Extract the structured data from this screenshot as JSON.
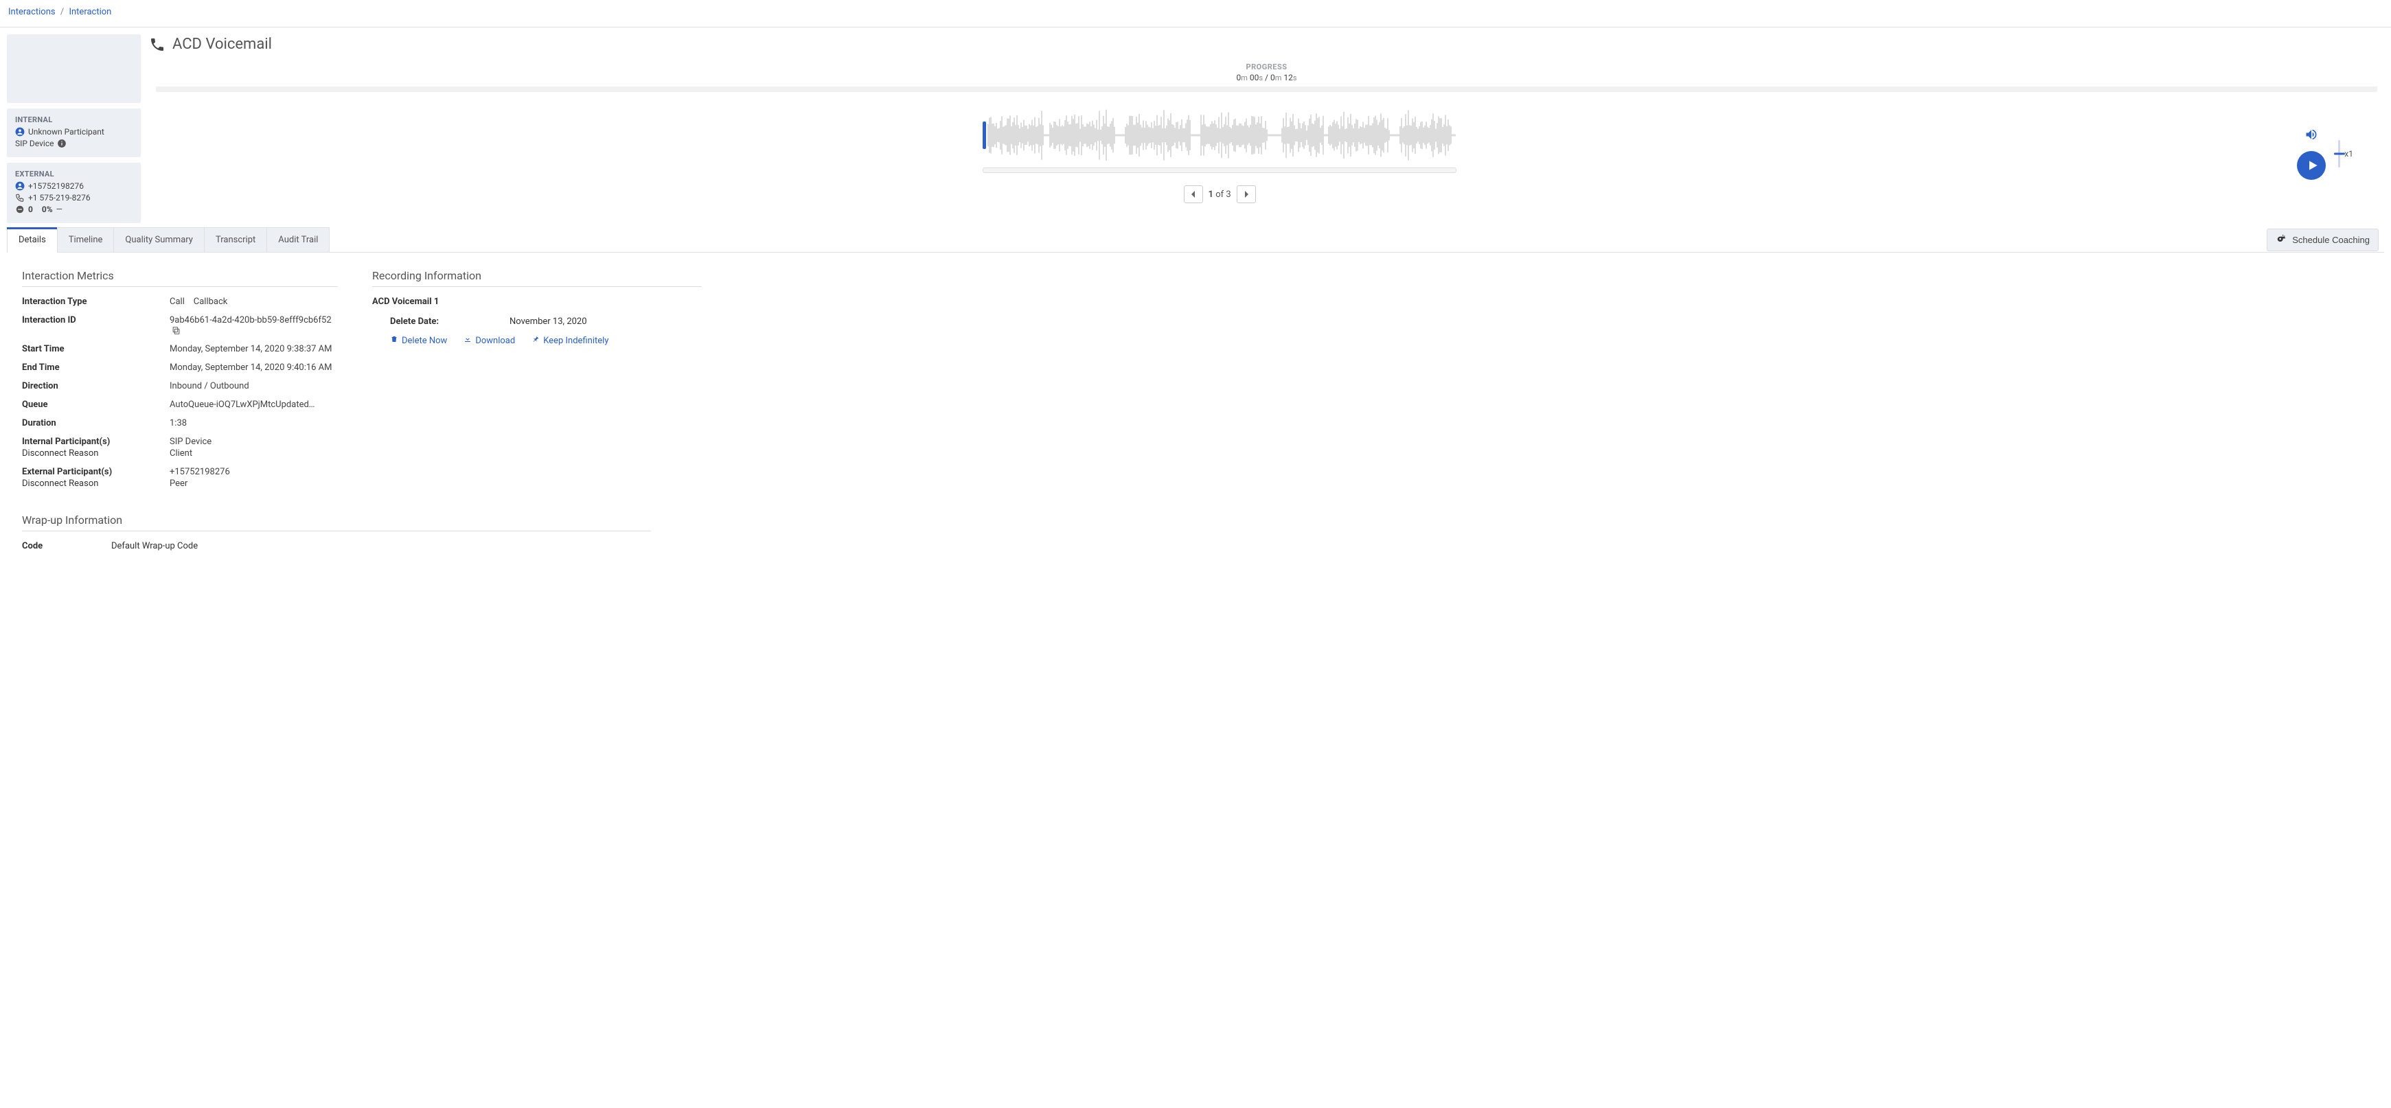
{
  "breadcrumb": {
    "parent": "Interactions",
    "current": "Interaction"
  },
  "title": "ACD Voicemail",
  "participants": {
    "internal": {
      "header": "INTERNAL",
      "name": "Unknown Participant",
      "device": "SIP Device"
    },
    "external": {
      "header": "EXTERNAL",
      "phone": "+15752198276",
      "phone_fmt": "+1 575-219-8276",
      "stat_count": "0",
      "stat_pct": "0%",
      "stat_trend": "—"
    }
  },
  "progress": {
    "label": "PROGRESS",
    "current_m": "0",
    "current_ms": "m",
    "current_s": "00",
    "current_ss": "s",
    "sep": " / ",
    "total_m": "0",
    "total_ms": "m",
    "total_s": "12",
    "total_ss": "s"
  },
  "pagination": {
    "page": "1",
    "of": "of",
    "total": "3"
  },
  "speed": {
    "label": "x1"
  },
  "tabs": {
    "details": "Details",
    "timeline": "Timeline",
    "quality": "Quality Summary",
    "transcript": "Transcript",
    "audit": "Audit Trail"
  },
  "scheduleCoaching": "Schedule Coaching",
  "metrics": {
    "title": "Interaction Metrics",
    "type_label": "Interaction Type",
    "type_value": "Call    Callback",
    "id_label": "Interaction ID",
    "id_value": "9ab46b61-4a2d-420b-bb59-8efff9cb6f52",
    "start_label": "Start Time",
    "start_value": "Monday, September 14, 2020 9:38:37 AM",
    "end_label": "End Time",
    "end_value": "Monday, September 14, 2020 9:40:16 AM",
    "direction_label": "Direction",
    "direction_value": "Inbound / Outbound",
    "queue_label": "Queue",
    "queue_value": "AutoQueue-iOQ7LwXPjMtcUpdated…",
    "duration_label": "Duration",
    "duration_value": "1:38",
    "internal_label": "Internal Participant(s)",
    "internal_sub": "Disconnect Reason",
    "internal_value": "SIP Device",
    "internal_value_sub": "Client",
    "external_label": "External Participant(s)",
    "external_sub": "Disconnect Reason",
    "external_value": "+15752198276",
    "external_value_sub": "Peer"
  },
  "recording": {
    "title": "Recording Information",
    "name": "ACD Voicemail 1",
    "delete_label": "Delete Date:",
    "delete_value": "November 13, 2020",
    "delete_now": "Delete Now",
    "download": "Download",
    "keep": "Keep Indefinitely"
  },
  "wrapup": {
    "title": "Wrap-up Information",
    "code_label": "Code",
    "code_value": "Default Wrap-up Code"
  }
}
